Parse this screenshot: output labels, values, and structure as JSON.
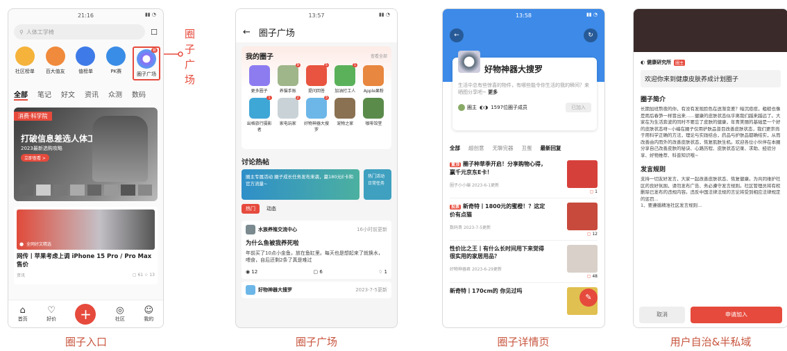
{
  "captions": [
    "圈子入口",
    "圈子广场",
    "圈子详情页",
    "用户自治&半私域"
  ],
  "annotation": "圈\n子\n广\n场",
  "p1": {
    "time": "21:16",
    "search_placeholder": "人体工学椅",
    "quick": [
      {
        "label": "社区榜单",
        "color": "#f5b33b"
      },
      {
        "label": "百大值友",
        "color": "#f08a3c"
      },
      {
        "label": "值榜单",
        "color": "#3e7be8"
      },
      {
        "label": "PK赛",
        "color": "#3a8de6"
      },
      {
        "label": "圈子广场",
        "color": "#6d5ef0",
        "badge": "新"
      }
    ],
    "tabs": [
      "全部",
      "笔记",
      "好文",
      "资讯",
      "众测",
      "数码"
    ],
    "banner_tag": "消费·科学院",
    "banner_title": "打破信息差选人体工学椅",
    "banner_sub": "2023最新选购攻略",
    "banner_btn": "立即查看 >",
    "card_tag": "全网好文精选",
    "card_title": "网传丨苹果考虑上调 iPhone 15 Pro / Pro Max 售价",
    "card_meta": "资讯",
    "card_c1": "61",
    "card_c2": "13",
    "nav": [
      {
        "icon": "⌂",
        "label": "首页"
      },
      {
        "icon": "♡",
        "label": "好价"
      },
      {
        "icon": "+",
        "label": ""
      },
      {
        "icon": "◎",
        "label": "社区"
      },
      {
        "icon": "☺",
        "label": "我的"
      }
    ]
  },
  "p2": {
    "time": "13:57",
    "title": "圈子广场",
    "mine_title": "我的圈子",
    "see_all": "查看全部",
    "items": [
      {
        "label": "更多圈子",
        "color": "#8d7cf0"
      },
      {
        "label": "养猫手账",
        "color": "#9fb58a",
        "badge": "9"
      },
      {
        "label": "提问回答",
        "color": "#e8543f",
        "badge": "5"
      },
      {
        "label": "加油打工人",
        "color": "#5ab15a",
        "badge": "1"
      },
      {
        "label": "Apple果粉",
        "color": "#e8873f"
      },
      {
        "label": "出格旅行摄影者",
        "color": "#3fa7d6",
        "badge": "1"
      },
      {
        "label": "家电玩家",
        "color": "#c9d2d6",
        "badge": "2"
      },
      {
        "label": "好物神器大搜罗",
        "color": "#6db6e8",
        "badge": "3"
      },
      {
        "label": "宠物之家",
        "color": "#8a7152"
      },
      {
        "label": "咖啡馆堂",
        "color": "#5a8b4a"
      }
    ],
    "discuss": "讨论热帖",
    "disc_text": "圈主专属活动 圈子成长任务发布来袭，赢180元E卡和官方流量~",
    "disc_text2": "热门活动 日常任务",
    "tab_hot": "热门",
    "tab_dyn": "动态",
    "post_author": "水族养殖交流中心",
    "post_time": "16小时前更新",
    "post_title": "为什么鱼被我养死啦",
    "post_body": "年前买了10点小金鱼，放在鱼缸里。每天也是想起来了就换水，喂食，自后还剩2条了真是难过",
    "post_views": "12",
    "post_comments": "6",
    "post_likes": "1",
    "post2_author": "好物神器大搜罗",
    "post2_time": "2023-7-5更新"
  },
  "p3": {
    "time": "13:58",
    "title": "好物神器大搜罗",
    "desc": "生活中总有些惊喜的物件，有哪些能令你生活的我的瞬间？来晒图分享吧~",
    "more": "更多",
    "members": "1597位圈子成员",
    "join": "已加入",
    "owner": "圈主",
    "tabs": [
      "全部",
      "超创意",
      "无聊完器",
      "丑蛋",
      "最新回复"
    ],
    "posts": [
      {
        "tag": "置顶",
        "title": "圈子种草季开启！分享购物心得，赢千元京东E卡！",
        "author": "圈子小小编",
        "date": "2023-6-1更新",
        "c": "1",
        "color": "#d6403a"
      },
      {
        "tag": "投票",
        "title": "新奇特丨1800元的蜜橙！？这定价有点猫",
        "author": "数码哥",
        "date": "2023-7-5更新",
        "c": "12",
        "color": "#c84a3c"
      },
      {
        "tag": "",
        "title": "性价比之王丨有什么长时间用下来觉得很实用的家居用品？",
        "author": "好物神器君",
        "date": "2023-6-29更新",
        "c": "48",
        "color": "#d9d0c9"
      },
      {
        "tag": "",
        "title": "新奇特丨170cm的 你见过吗",
        "author": "",
        "date": "",
        "c": "",
        "color": "#e0c050"
      }
    ]
  },
  "p4": {
    "owner": "健康研究所",
    "role": "圈主",
    "welcome": "欢迎你来到健康皮肤养成计划圈子",
    "intro_t": "圈子简介",
    "intro": "长期加班熬夜的你，有没有发现脸色在逐渐变差？暗沉痘痘，粗糙也像是雨后春笋一样冒出来……健康的皮肤状态似乎离我们越来越远了。大家在为生活奔波的同时不要忘了皮肤的健康，年青美丽的基础是一个好的皮肤状态呀~小编在圈子仅用护肤品普目改善皮肤状态，我们更崇尚于用科学正确的方法，理论与实践结合，药品与护肤品都确结实，从而改善由内而外的改善皮肤状态，恢复肌肤生机。欢迎各位小伙伴在本圈分享自己改善皮肤的秘诀、心路历程、皮肤状态记录、求助、经验分享、好物推荐、科普知识哦~",
    "rules_t": "发言规则",
    "rules": "支持一切友好发言，大家一起改善皮肤状态、恢复健康。为共同维护社区的良好氛围，请勿发布广告、务必遵守发言规则。社区管理员将有权删除已发布的违规内容。违反中国法律法规的言论将受到相应法律规定的惩罚...\n1、要遵循精准社区发言规则...",
    "cancel": "取消",
    "apply": "申请加入"
  }
}
